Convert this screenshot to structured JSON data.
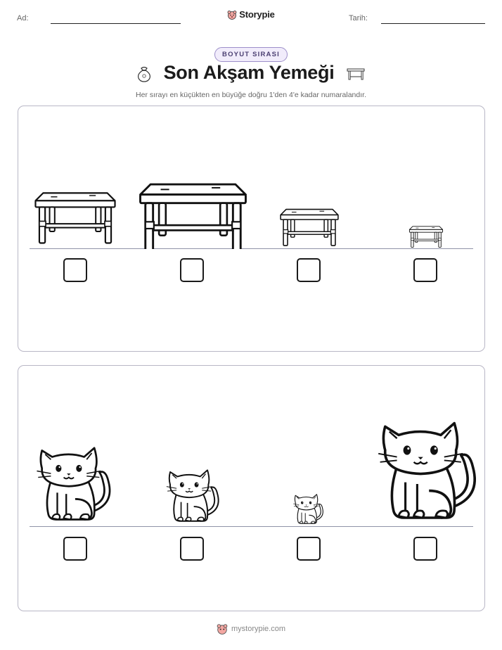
{
  "header": {
    "name_label": "Ad:",
    "date_label": "Tarih:",
    "brand": "Storypie"
  },
  "worksheet": {
    "category_badge": "BOYUT SIRASI",
    "title": "Son Akşam Yemeği",
    "instruction": "Her sırayı en küçükten en büyüğe doğru 1'den 4'e kadar numaralandır.",
    "title_icons": [
      "money-bag-icon",
      "bench-icon"
    ]
  },
  "rows": [
    {
      "subject": "bench-icon",
      "relative_sizes": [
        0.72,
        0.97,
        0.52,
        0.3
      ],
      "answers": [
        "",
        "",
        "",
        ""
      ]
    },
    {
      "subject": "cat-icon",
      "relative_sizes": [
        0.72,
        0.52,
        0.3,
        0.97
      ],
      "answers": [
        "",
        "",
        "",
        ""
      ]
    }
  ],
  "footer": {
    "url": "mystorypie.com"
  },
  "colors": {
    "badge_border": "#9d8fc9",
    "badge_fill": "#f1ecfb",
    "panel_border": "#b9b7c6",
    "baseline": "#8f93a8"
  }
}
